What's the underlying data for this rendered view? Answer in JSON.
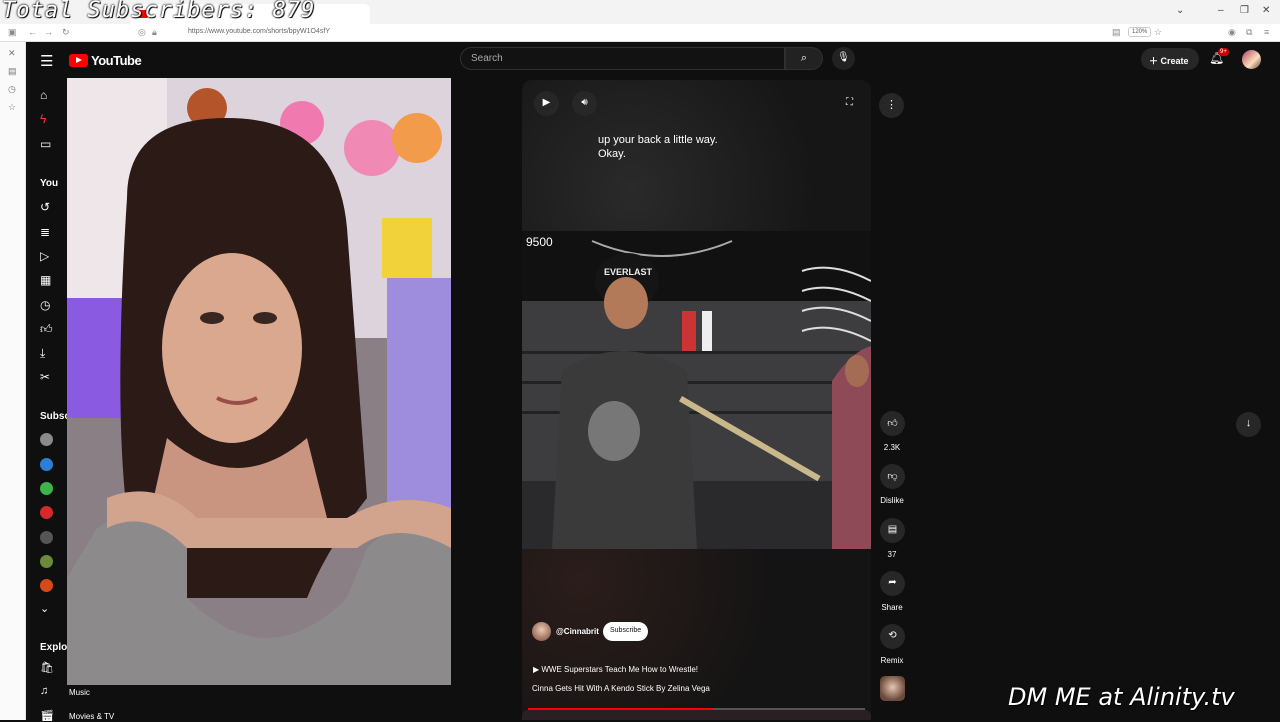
{
  "overlays": {
    "subscribers": "Total Subscribers: 879",
    "dm": "DM ME at Alinity.tv"
  },
  "browser": {
    "url": "https://www.youtube.com/shorts/bpyW1O4sfY",
    "zoom": "120%"
  },
  "header": {
    "logo_text": "YouTube",
    "search_placeholder": "Search",
    "create_label": "Create",
    "notification_count": "9+"
  },
  "sidebar": {
    "you_label": "You",
    "subscriptions_label": "Subsc",
    "explore_label": "Explor",
    "explore_items": [
      "Music",
      "Movies & TV"
    ]
  },
  "short": {
    "caption_line1": "up your back a little way.",
    "caption_line2": "Okay.",
    "overlay_number": "9500",
    "helmet_text": "EVERLAST",
    "channel": "@Cinnabrit",
    "subscribe_label": "Subscribe",
    "music_title": "WWE Superstars Teach Me How to Wrestle!",
    "video_title": "Cinna Gets Hit With A Kendo Stick By Zelina Vega",
    "progress": 0.55
  },
  "actions": {
    "likes": "2.3K",
    "dislike_label": "Dislike",
    "comments": "37",
    "share_label": "Share",
    "remix_label": "Remix"
  },
  "colors": {
    "brand": "#ff0000",
    "background": "#0f0f0f"
  }
}
